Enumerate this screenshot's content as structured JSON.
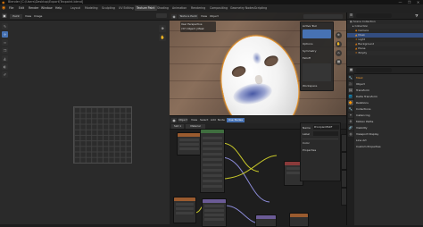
{
  "window": {
    "title": "Blender [C:\\Users\\Desktop\\Export\\Texpaint.blend]",
    "controls": [
      "—",
      "❐",
      "✕"
    ]
  },
  "menu": {
    "items": [
      "File",
      "Edit",
      "Render",
      "Window",
      "Help"
    ],
    "workspaces": [
      "Layout",
      "Modeling",
      "Sculpting",
      "UV Editing",
      "Texture Paint",
      "Shading",
      "Animation",
      "Rendering",
      "Compositing",
      "Geometry Nodes",
      "Scripting"
    ],
    "active_workspace": "Texture Paint"
  },
  "image_editor": {
    "mode": "Paint",
    "menus": [
      "View",
      "Image"
    ]
  },
  "viewport": {
    "mode": "Texture Paint",
    "menus": [
      "View",
      "Object"
    ],
    "overlay_lines": [
      "User Perspective",
      "(37) Object | Mask"
    ],
    "panel_title": "Active Tool",
    "panel_items": [
      "Options",
      "Symmetry",
      "Falloff",
      "Workspace"
    ]
  },
  "node_editor": {
    "menus": [
      "Object",
      "View",
      "Select",
      "Add",
      "Node"
    ],
    "toggle": "Use Nodes",
    "slot": "Slot 1",
    "material": "Material",
    "nodes": [
      {
        "title": "Principled BSDF",
        "color": "#3f6e3f"
      },
      {
        "title": "Mix",
        "color": "#6b5b96"
      },
      {
        "title": "Image Texture",
        "color": "#9a5b2f"
      },
      {
        "title": "Material Output",
        "color": "#8a3a3a"
      },
      {
        "title": "Normal Map",
        "color": "#6b5b96"
      }
    ],
    "npanel": {
      "name_label": "Name",
      "name_value": "Principled BSDF",
      "label_label": "Label",
      "sections": [
        "Color",
        "Properties"
      ]
    },
    "npanel_tabs": [
      "Node",
      "Tool",
      "View",
      "Options"
    ]
  },
  "outliner": {
    "title": "Scene Collection",
    "rows": [
      {
        "label": "Scene Collection"
      },
      {
        "label": "Collection"
      },
      {
        "label": "Camera"
      },
      {
        "label": "Mask"
      },
      {
        "label": "Light"
      },
      {
        "label": "Background"
      },
      {
        "label": "Plane"
      },
      {
        "label": "Empty"
      }
    ]
  },
  "properties": {
    "title": "Mask",
    "sections": [
      "Object",
      "Transform",
      "Delta Transform",
      "Relations",
      "Collections",
      "Instancing",
      "Motion Paths",
      "Visibility",
      "Viewport Display",
      "Line Art",
      "Custom Properties"
    ],
    "tab_icons": [
      "🔧",
      "🎥",
      "🖼",
      "🌐",
      "🔶",
      "🔧",
      "✦",
      "⚙",
      "🔗",
      "◍"
    ],
    "active_tab": 4
  },
  "colors": {
    "accent": "#4772b3",
    "selection_outline": "#e8962e",
    "paint_blue": "#3c50a0"
  }
}
